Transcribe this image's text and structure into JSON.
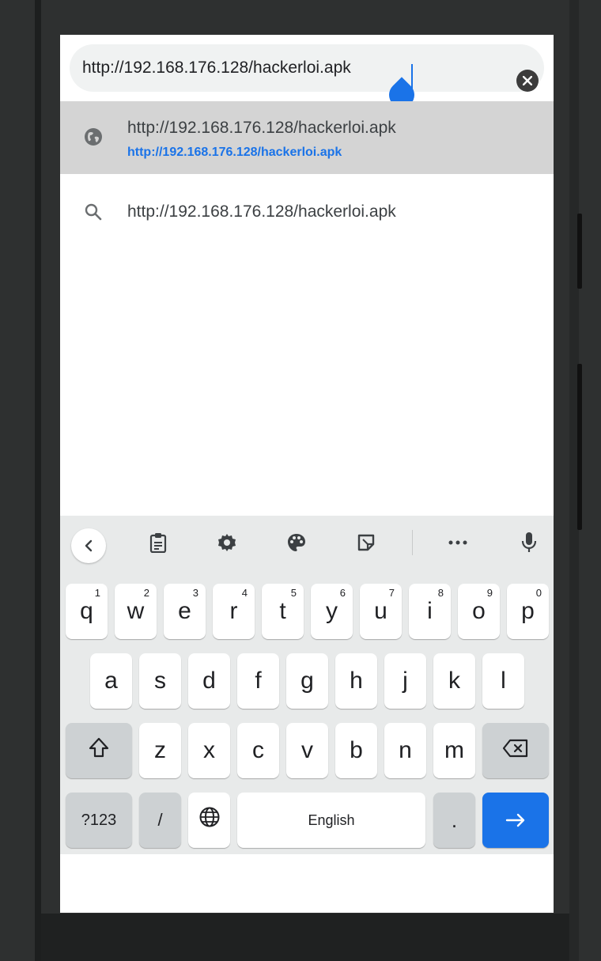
{
  "browser": {
    "url_value": "http://192.168.176.128/hackerloi.apk",
    "clear_icon": "close-circle-icon"
  },
  "suggestions": [
    {
      "icon": "globe-icon",
      "title": "http://192.168.176.128/hackerloi.apk",
      "url": "http://192.168.176.128/hackerloi.apk"
    },
    {
      "icon": "search-icon",
      "title": "http://192.168.176.128/hackerloi.apk"
    }
  ],
  "keyboard": {
    "toolbar_icons": [
      "chevron-left-icon",
      "clipboard-icon",
      "gear-icon",
      "palette-icon",
      "sticker-icon",
      "more-icon",
      "mic-icon"
    ],
    "row1": [
      {
        "key": "q",
        "hint": "1"
      },
      {
        "key": "w",
        "hint": "2"
      },
      {
        "key": "e",
        "hint": "3"
      },
      {
        "key": "r",
        "hint": "4"
      },
      {
        "key": "t",
        "hint": "5"
      },
      {
        "key": "y",
        "hint": "6"
      },
      {
        "key": "u",
        "hint": "7"
      },
      {
        "key": "i",
        "hint": "8"
      },
      {
        "key": "o",
        "hint": "9"
      },
      {
        "key": "p",
        "hint": "0"
      }
    ],
    "row2": [
      "a",
      "s",
      "d",
      "f",
      "g",
      "h",
      "j",
      "k",
      "l"
    ],
    "row3": [
      "z",
      "x",
      "c",
      "v",
      "b",
      "n",
      "m"
    ],
    "symbols_label": "?123",
    "slash_label": "/",
    "space_label": "English",
    "period_label": ".",
    "enter_icon": "arrow-right-icon",
    "shift_icon": "shift-icon",
    "backspace_icon": "backspace-icon",
    "language_icon": "globe-icon",
    "accent_color": "#1a73e8"
  }
}
